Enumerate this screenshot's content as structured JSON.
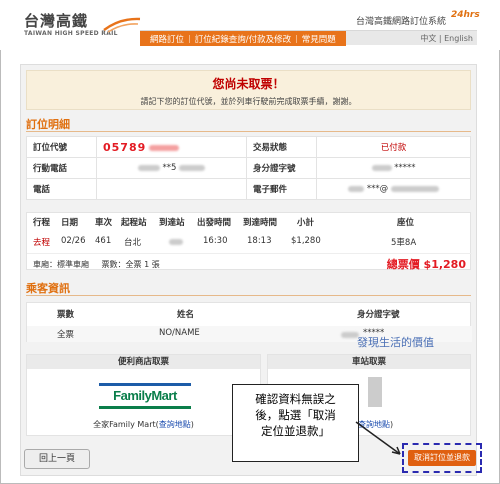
{
  "header": {
    "logo_zh": "台灣高鐵",
    "logo_en": "TAIWAN HIGH SPEED RAIL",
    "site_name": "台灣高鐵網路訂位系統",
    "badge": "24hrs",
    "nav": [
      "網路訂位",
      "訂位紀錄查詢/付款及修改",
      "常見問題"
    ],
    "lang": "中文 | English"
  },
  "notice": {
    "title": "您尚未取票！",
    "subtitle": "請記下您的訂位代號，並於列車行駛前完成取票手續，謝謝。"
  },
  "booking": {
    "section_title": "訂位明細",
    "code_label": "訂位代號",
    "code_value": "05789",
    "status_label": "交易狀態",
    "status_value": "已付款",
    "mobile_label": "行動電話",
    "mobile_value": "**5",
    "id_label": "身分證字號",
    "id_value": "*****",
    "phone_label": "電話",
    "email_label": "電子郵件",
    "email_value": "***@"
  },
  "trip": {
    "headers": [
      "行程",
      "日期",
      "車次",
      "起程站",
      "到達站",
      "出發時間",
      "到達時間",
      "小計",
      "座位"
    ],
    "row": [
      "去程",
      "02/26",
      "461",
      "台北",
      "",
      "16:30",
      "18:13",
      "$1,280",
      "5車8A"
    ],
    "car_type": "車廂：標準車廂",
    "ticket_count": "票數：全票 1 張",
    "total_label": "總票價",
    "total_value": "$1,280"
  },
  "passenger": {
    "section_title": "乘客資訊",
    "headers": [
      "票數",
      "姓名",
      "身分證字號"
    ],
    "row": [
      "全票",
      "NO/NAME",
      "*****"
    ]
  },
  "watermark": "發現生活的價值",
  "pickup": {
    "store_title": "便利商店取票",
    "store_logo": "FamilyMart",
    "store_name": "全家Family Mart(",
    "store_link": "查詢地點",
    "store_close": ")",
    "station_title": "車站取票",
    "station_link": "查詢地點",
    "station_close": ")"
  },
  "buttons": {
    "back": "回上一頁",
    "cancel": "取消訂位並退款"
  },
  "callout": {
    "lines": [
      "確認資料無誤之",
      "後，點選「取消",
      "定位並退款」"
    ]
  },
  "colors": {
    "accent": "#e8731a",
    "alert": "#e31b23",
    "familymart_green": "#0a7e4a",
    "familymart_blue": "#1d5ca8"
  }
}
